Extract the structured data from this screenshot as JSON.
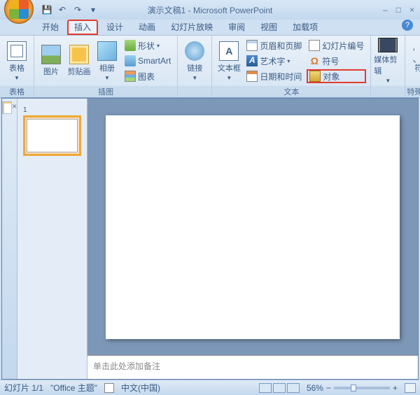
{
  "title": "演示文稿1 - Microsoft PowerPoint",
  "tabs": {
    "home": "开始",
    "insert": "插入",
    "design": "设计",
    "anim": "动画",
    "slideshow": "幻灯片放映",
    "review": "审阅",
    "view": "视图",
    "addin": "加载项"
  },
  "groups": {
    "tables": {
      "label": "表格",
      "btn": "表格"
    },
    "illus": {
      "label": "插图",
      "pic": "图片",
      "clip": "剪贴画",
      "album": "相册",
      "shape": "形状",
      "smart": "SmartArt",
      "chart": "图表"
    },
    "link": {
      "label": "",
      "btn": "链接"
    },
    "text": {
      "label": "文本",
      "box": "文本框",
      "hdr": "页眉和页脚",
      "wa": "艺术字",
      "date": "日期和时间",
      "num": "幻灯片编号",
      "sym": "符号",
      "obj": "对象"
    },
    "media": {
      "label": "",
      "btn": "媒体剪辑"
    },
    "special": {
      "label": "特殊符号",
      "btn": "符号"
    }
  },
  "thumb_num": "1",
  "notes": "单击此处添加备注",
  "status": {
    "slide": "幻灯片 1/1",
    "theme": "\"Office 主题\"",
    "lang": "中文(中国)",
    "zoom": "56%"
  }
}
